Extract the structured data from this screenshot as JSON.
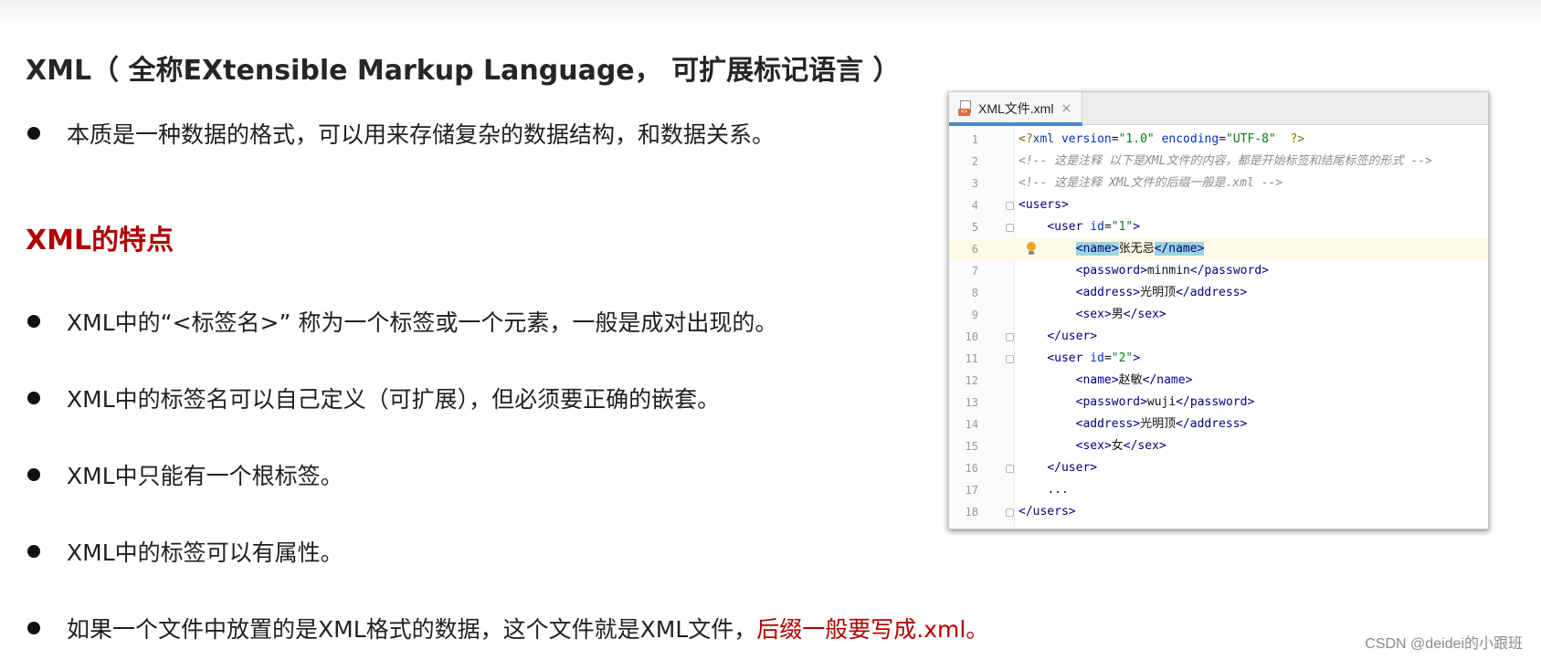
{
  "slide": {
    "title": "XML（ 全称EXtensible Markup Language， 可扩展标记语言 ）",
    "intro_bullet": "本质是一种数据的格式，可以用来存储复杂的数据结构，和数据关系。",
    "features_heading": "XML的特点",
    "feature_bullets": [
      "XML中的“<标签名>” 称为一个标签或一个元素，一般是成对出现的。",
      "XML中的标签名可以自己定义（可扩展），但必须要正确的嵌套。",
      "XML中只能有一个根标签。",
      "XML中的标签可以有属性。"
    ],
    "last_bullet": {
      "normal": "如果一个文件中放置的是XML格式的数据，这个文件就是XML文件，",
      "highlight": "后缀一般要写成.xml。"
    }
  },
  "editor": {
    "tab_label": "XML文件.xml",
    "tab_close": "×",
    "file_icon_text": "<>",
    "icons": [
      "xml-file-icon",
      "close-icon",
      "fold-icon",
      "lightbulb-icon"
    ],
    "lines": [
      {
        "n": "1",
        "code": "<?xml version=\"1.0\" encoding=\"UTF-8\" ?>"
      },
      {
        "n": "2",
        "code": "<!-- 这是注释 以下是XML文件的内容，都是开始标签和结尾标签的形式 -->"
      },
      {
        "n": "3",
        "code": "<!-- 这是注释 XML文件的后缀一般是.xml -->"
      },
      {
        "n": "4",
        "code": "<users>"
      },
      {
        "n": "5",
        "code": "    <user id=\"1\">"
      },
      {
        "n": "6",
        "code": "        <name>张无忌</name>"
      },
      {
        "n": "7",
        "code": "        <password>minmin</password>"
      },
      {
        "n": "8",
        "code": "        <address>光明顶</address>"
      },
      {
        "n": "9",
        "code": "        <sex>男</sex>"
      },
      {
        "n": "10",
        "code": "    </user>"
      },
      {
        "n": "11",
        "code": "    <user id=\"2\">"
      },
      {
        "n": "12",
        "code": "        <name>赵敏</name>"
      },
      {
        "n": "13",
        "code": "        <password>wuji</password>"
      },
      {
        "n": "14",
        "code": "        <address>光明顶</address>"
      },
      {
        "n": "15",
        "code": "        <sex>女</sex>"
      },
      {
        "n": "16",
        "code": "    </user>"
      },
      {
        "n": "17",
        "code": "    ..."
      },
      {
        "n": "18",
        "code": "</users>"
      }
    ],
    "highlighted_line": "6",
    "colors": {
      "tag": "#000080",
      "attribute": "#0033b3",
      "value": "#067d17",
      "comment": "#8c8c8c",
      "tab_underline": "#4a88c7",
      "caret_line": "#fdfbe5",
      "tag_match": "#99d6e0"
    }
  },
  "watermark": "CSDN @deidei的小跟班",
  "colors": {
    "heading_red": "#b00000",
    "highlight_red": "#b10000"
  }
}
